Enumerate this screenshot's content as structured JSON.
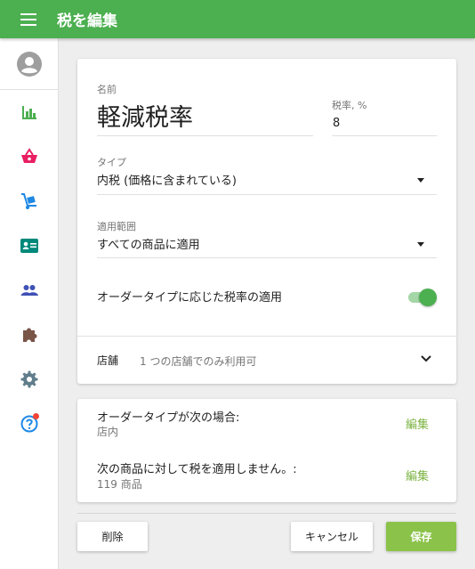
{
  "appbar": {
    "title": "税を編集"
  },
  "form": {
    "name_label": "名前",
    "name_value": "軽減税率",
    "rate_label": "税率, %",
    "rate_value": "8",
    "type_label": "タイプ",
    "type_value": "内税 (価格に含まれている)",
    "scope_label": "適用範囲",
    "scope_value": "すべての商品に適用",
    "order_type_toggle_label": "オーダータイプに応じた税率の適用",
    "order_type_toggle_on": true,
    "store_label": "店舗",
    "store_value": "1 つの店舗でのみ利用可"
  },
  "conditions": {
    "order_type_title": "オーダータイプが次の場合:",
    "order_type_value": "店内",
    "exclude_title": "次の商品に対して税を適用しません。:",
    "exclude_value": "119 商品",
    "edit_label": "編集"
  },
  "actions": {
    "delete": "削除",
    "cancel": "キャンセル",
    "save": "保存"
  },
  "colors": {
    "primary": "#4caf50",
    "accent_link": "#7cb342",
    "save_button": "#8bc34a",
    "notification_dot": "#f44336"
  }
}
